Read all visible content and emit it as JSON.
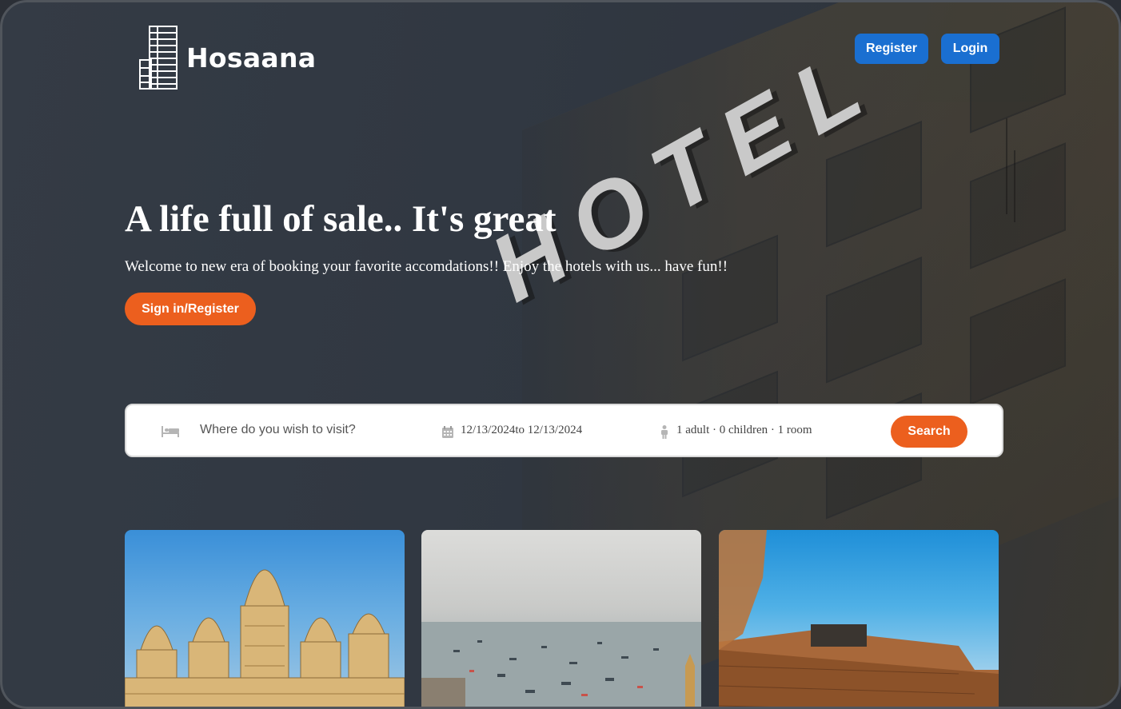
{
  "header": {
    "brand": "Hosaana",
    "register_label": "Register",
    "login_label": "Login"
  },
  "hero": {
    "title": "A life full of sale.. It's great",
    "subtitle": "Welcome to new era of booking your favorite accomdations!! Enjoy the hotels with us... have fun!!",
    "cta_label": "Sign in/Register",
    "background_sign": "HOTEL"
  },
  "search": {
    "destination_placeholder": "Where do you wish to visit?",
    "dates": "12/13/2024to 12/13/2024",
    "occupancy": "1 adult · 0 children · 1 room",
    "button_label": "Search",
    "icons": [
      "bed-icon",
      "calendar-icon",
      "person-icon"
    ]
  },
  "cards": [
    {
      "name": "temple-photo"
    },
    {
      "name": "harbor-boats-photo"
    },
    {
      "name": "fort-photo"
    }
  ],
  "colors": {
    "accent_orange": "#ec5f1e",
    "brand_blue": "#1a6fd1",
    "hero_overlay": "#313842"
  }
}
